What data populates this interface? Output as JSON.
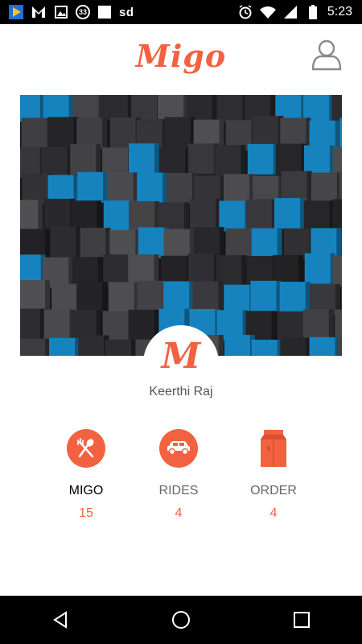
{
  "status_bar": {
    "notification_count": "33",
    "carrier_text": "sd",
    "time": "5:23",
    "icons": [
      "play-store-icon",
      "mail-icon",
      "image-icon",
      "badge-icon",
      "square-icon",
      "alarm-icon",
      "wifi-icon",
      "signal-icon",
      "battery-icon"
    ]
  },
  "header": {
    "logo": "Migo",
    "profile_icon": "person-icon"
  },
  "profile": {
    "avatar_letter": "M",
    "name": "Keerthi Raj"
  },
  "stats": [
    {
      "label": "MIGO",
      "count": "15",
      "icon": "fork-spoon-icon",
      "active": true
    },
    {
      "label": "RIDES",
      "count": "4",
      "icon": "car-icon",
      "active": false
    },
    {
      "label": "ORDER",
      "count": "4",
      "icon": "bag-icon",
      "active": false
    }
  ],
  "nav_bar": {
    "icons": [
      "back-icon",
      "home-icon",
      "recents-icon"
    ]
  },
  "colors": {
    "accent": "#f26241",
    "cube_blue": "#1b9be0"
  }
}
